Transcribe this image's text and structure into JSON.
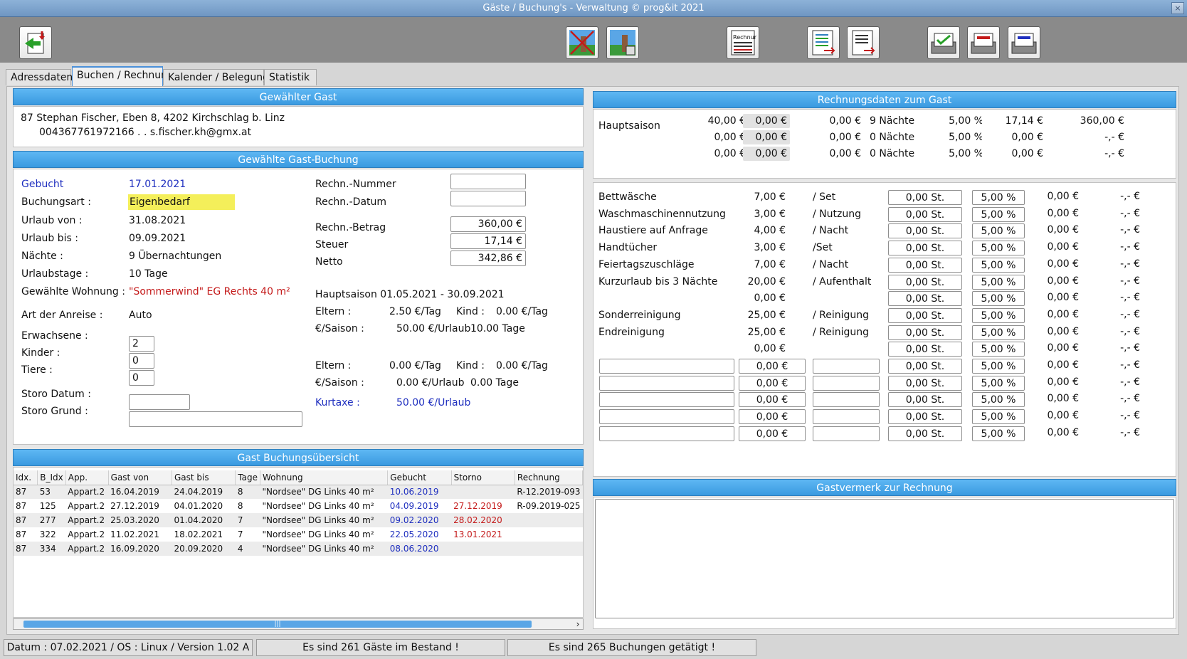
{
  "window": {
    "title": "Gäste / Buchung's - Verwaltung ©    prog&it 2021",
    "close_label": "×"
  },
  "toolbar": {
    "buttons": [
      {
        "name": "exit-icon"
      },
      {
        "name": "cancel-booking-icon"
      },
      {
        "name": "print-booking-icon"
      },
      {
        "name": "invoice-icon"
      },
      {
        "name": "list-export-icon"
      },
      {
        "name": "document-export-icon"
      },
      {
        "name": "mail-green-icon"
      },
      {
        "name": "mail-red-icon"
      },
      {
        "name": "mail-blue-icon"
      }
    ],
    "invoice_icon_text": "Rechnung"
  },
  "tabs": [
    "Adressdaten",
    "Buchen / Rechnung",
    "Kalender  /  Belegung",
    "Statistik"
  ],
  "guest": {
    "header": "Gewählter Gast",
    "line1": "87   Stephan Fischer,  Eben 8,  4202 Kirchschlag b. Linz",
    "line2": "004367761972166 .  . s.fischer.kh@gmx.at"
  },
  "booking": {
    "header": "Gewählte Gast-Buchung",
    "gebucht_label": "Gebucht",
    "gebucht_value": "17.01.2021",
    "art_label": "Buchungsart :",
    "art_value": "Eigenbedarf",
    "von_label": "Urlaub von :",
    "von_value": "31.08.2021",
    "bis_label": "Urlaub bis :",
    "bis_value": "09.09.2021",
    "naechte_label": "Nächte :",
    "naechte_value": "9  Übernachtungen",
    "tage_label": "Urlaubstage :",
    "tage_value": "10  Tage",
    "wohnung_label": "Gewählte Wohnung :",
    "wohnung_value": "\"Sommerwind\"  EG Rechts 40 m²",
    "anreise_label": "Art der Anreise :",
    "anreise_value": "Auto",
    "erw_label": "Erwachsene :",
    "erw_value": "2",
    "kinder_label": "Kinder :",
    "kinder_value": "0",
    "tiere_label": "Tiere :",
    "tiere_value": "0",
    "storo_datum_label": "Storo Datum :",
    "storo_grund_label": "Storo Grund :",
    "rechn_nr_label": "Rechn.-Nummer",
    "rechn_datum_label": "Rechn.-Datum",
    "betrag_label": "Rechn.-Betrag",
    "betrag_value": "360,00 €",
    "steuer_label": "Steuer",
    "steuer_value": "17,14 €",
    "netto_label": "Netto",
    "netto_value": "342,86 €",
    "saison_title": "Hauptsaison  01.05.2021 - 30.09.2021",
    "eltern_label": "Eltern :",
    "eltern1": "2.50 €/Tag",
    "kind_label": "Kind :",
    "kind1": "0.00 €/Tag",
    "saison_label": "€/Saison :",
    "saison1": "50.00 €/Urlaub",
    "saison1_tage": "10.00 Tage",
    "eltern2": "0.00 €/Tag",
    "kind2": "0.00 €/Tag",
    "saison2": "0.00 €/Urlaub",
    "saison2_tage": "0.00 Tage",
    "kurtaxe_label": "Kurtaxe :",
    "kurtaxe_value": "50.00 €/Urlaub"
  },
  "overview": {
    "header": "Gast Buchungsübersicht",
    "columns": [
      "Idx.",
      "B_Idx",
      "App.",
      "Gast von",
      "Gast bis",
      "Tage",
      "Wohnung",
      "Gebucht",
      "Storno",
      "Rechnung"
    ],
    "rows": [
      [
        "87",
        "53",
        "Appart.2",
        "16.04.2019",
        "24.04.2019",
        "8",
        "\"Nordsee\"  DG Links 40 m²",
        "10.06.2019",
        "",
        "R-12.2019-093"
      ],
      [
        "87",
        "125",
        "Appart.2",
        "27.12.2019",
        "04.01.2020",
        "8",
        "\"Nordsee\"  DG Links 40 m²",
        "04.09.2019",
        "27.12.2019",
        "R-09.2019-025"
      ],
      [
        "87",
        "277",
        "Appart.2",
        "25.03.2020",
        "01.04.2020",
        "7",
        "\"Nordsee\"  DG Links 40 m²",
        "09.02.2020",
        "28.02.2020",
        ""
      ],
      [
        "87",
        "322",
        "Appart.2",
        "11.02.2021",
        "18.02.2021",
        "7",
        "\"Nordsee\"  DG Links 40 m²",
        "22.05.2020",
        "13.01.2021",
        ""
      ],
      [
        "87",
        "334",
        "Appart.2",
        "16.09.2020",
        "20.09.2020",
        "4",
        "\"Nordsee\"  DG Links 40 m²",
        "08.06.2020",
        "",
        ""
      ]
    ],
    "scroll_grip": "|||",
    "scroll_right": "›"
  },
  "invoice": {
    "header": "Rechnungsdaten zum Gast",
    "season_label": "Hauptsaison",
    "season_rows": [
      [
        "40,00 €",
        "0,00 €",
        "0,00 €",
        "9  Nächte",
        "5,00 %",
        "17,14 €",
        "360,00 €"
      ],
      [
        "0,00 €",
        "0,00 €",
        "0,00 €",
        "0  Nächte",
        "5,00 %",
        "0,00 €",
        "-,- €"
      ],
      [
        "0,00 €",
        "0,00 €",
        "0,00 €",
        "0  Nächte",
        "5,00 %",
        "0,00 €",
        "-,- €"
      ]
    ],
    "extras": [
      [
        "Bettwäsche",
        "7,00 €",
        "/ Set"
      ],
      [
        "Waschmaschinennutzung",
        "3,00 €",
        "/ Nutzung"
      ],
      [
        "Haustiere auf Anfrage",
        "4,00 €",
        "/ Nacht"
      ],
      [
        " Handtücher",
        "3,00 €",
        "/Set"
      ],
      [
        "Feiertagszuschläge",
        "7,00 €",
        "/ Nacht"
      ],
      [
        "Kurzurlaub bis 3 Nächte",
        "20,00 €",
        "/ Aufenthalt"
      ],
      [
        "",
        "0,00 €",
        ""
      ],
      [
        " Sonderreinigung",
        "25,00 €",
        "/ Reinigung"
      ],
      [
        " Endreinigung",
        "25,00 €",
        "/ Reinigung"
      ],
      [
        "",
        "0,00 €",
        ""
      ]
    ],
    "qty": "0,00 St.",
    "pct": "5,00 %",
    "tax": "0,00 €",
    "total": "-,- €",
    "custom_price": "0,00 €"
  },
  "note": {
    "header": "Gastvermerk zur Rechnung",
    "text": ""
  },
  "status": {
    "info": "Datum : 07.02.2021 / OS : Linux  /  Version 1.02 A",
    "guests": "Es sind 261 Gäste im Bestand !",
    "bookings": "Es sind 265 Buchungen getätigt !"
  }
}
